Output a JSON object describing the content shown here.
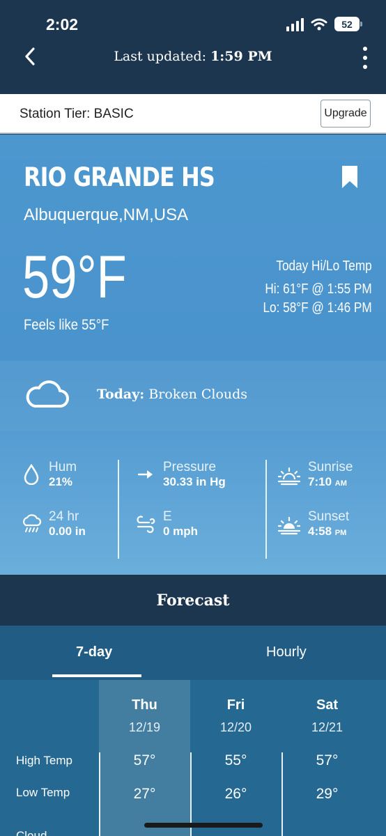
{
  "status": {
    "time": "2:02",
    "battery": "52"
  },
  "header": {
    "updated_prefix": "Last updated:",
    "updated_time": "1:59 PM"
  },
  "tier": {
    "label": "Station Tier: BASIC",
    "upgrade_label": "Upgrade"
  },
  "station": {
    "name": "RIO GRANDE HS",
    "location": "Albuquerque,NM,USA",
    "temperature": "59°F",
    "feels_like": "Feels like 55°F",
    "hilo_title": "Today Hi/Lo Temp",
    "hi": "Hi: 61°F @ 1:55 PM",
    "lo": "Lo: 58°F @ 1:46 PM",
    "today_label": "Today:",
    "today_condition": "Broken Clouds"
  },
  "metrics": {
    "humidity": {
      "label": "Hum",
      "value": "21%"
    },
    "rain": {
      "label": "24 hr",
      "value": "0.00 in"
    },
    "pressure": {
      "label": "Pressure",
      "value": "30.33 in Hg"
    },
    "wind": {
      "label": "E",
      "value": "0 mph"
    },
    "sunrise": {
      "label": "Sunrise",
      "value": "7:10",
      "unit": "AM"
    },
    "sunset": {
      "label": "Sunset",
      "value": "4:58",
      "unit": "PM"
    }
  },
  "forecast": {
    "title": "Forecast",
    "tabs": [
      "7-day",
      "Hourly"
    ],
    "row_labels": [
      "High Temp",
      "Low Temp",
      "Cloud"
    ],
    "days": [
      {
        "name": "Thu",
        "date": "12/19",
        "high": "57°",
        "low": "27°"
      },
      {
        "name": "Fri",
        "date": "12/20",
        "high": "55°",
        "low": "26°"
      },
      {
        "name": "Sat",
        "date": "12/21",
        "high": "57°",
        "low": "29°"
      }
    ]
  },
  "colors": {
    "header": "#1d3650",
    "station_blue": "#4d97cf",
    "forecast_grid": "#256891",
    "tabs": "#215c84"
  },
  "icons": [
    "chevron-left-icon",
    "kebab-menu-icon",
    "bookmark-icon",
    "cloud-icon",
    "droplet-icon",
    "rain-icon",
    "arrow-right-icon",
    "wind-icon",
    "sunrise-icon",
    "sunset-icon"
  ]
}
